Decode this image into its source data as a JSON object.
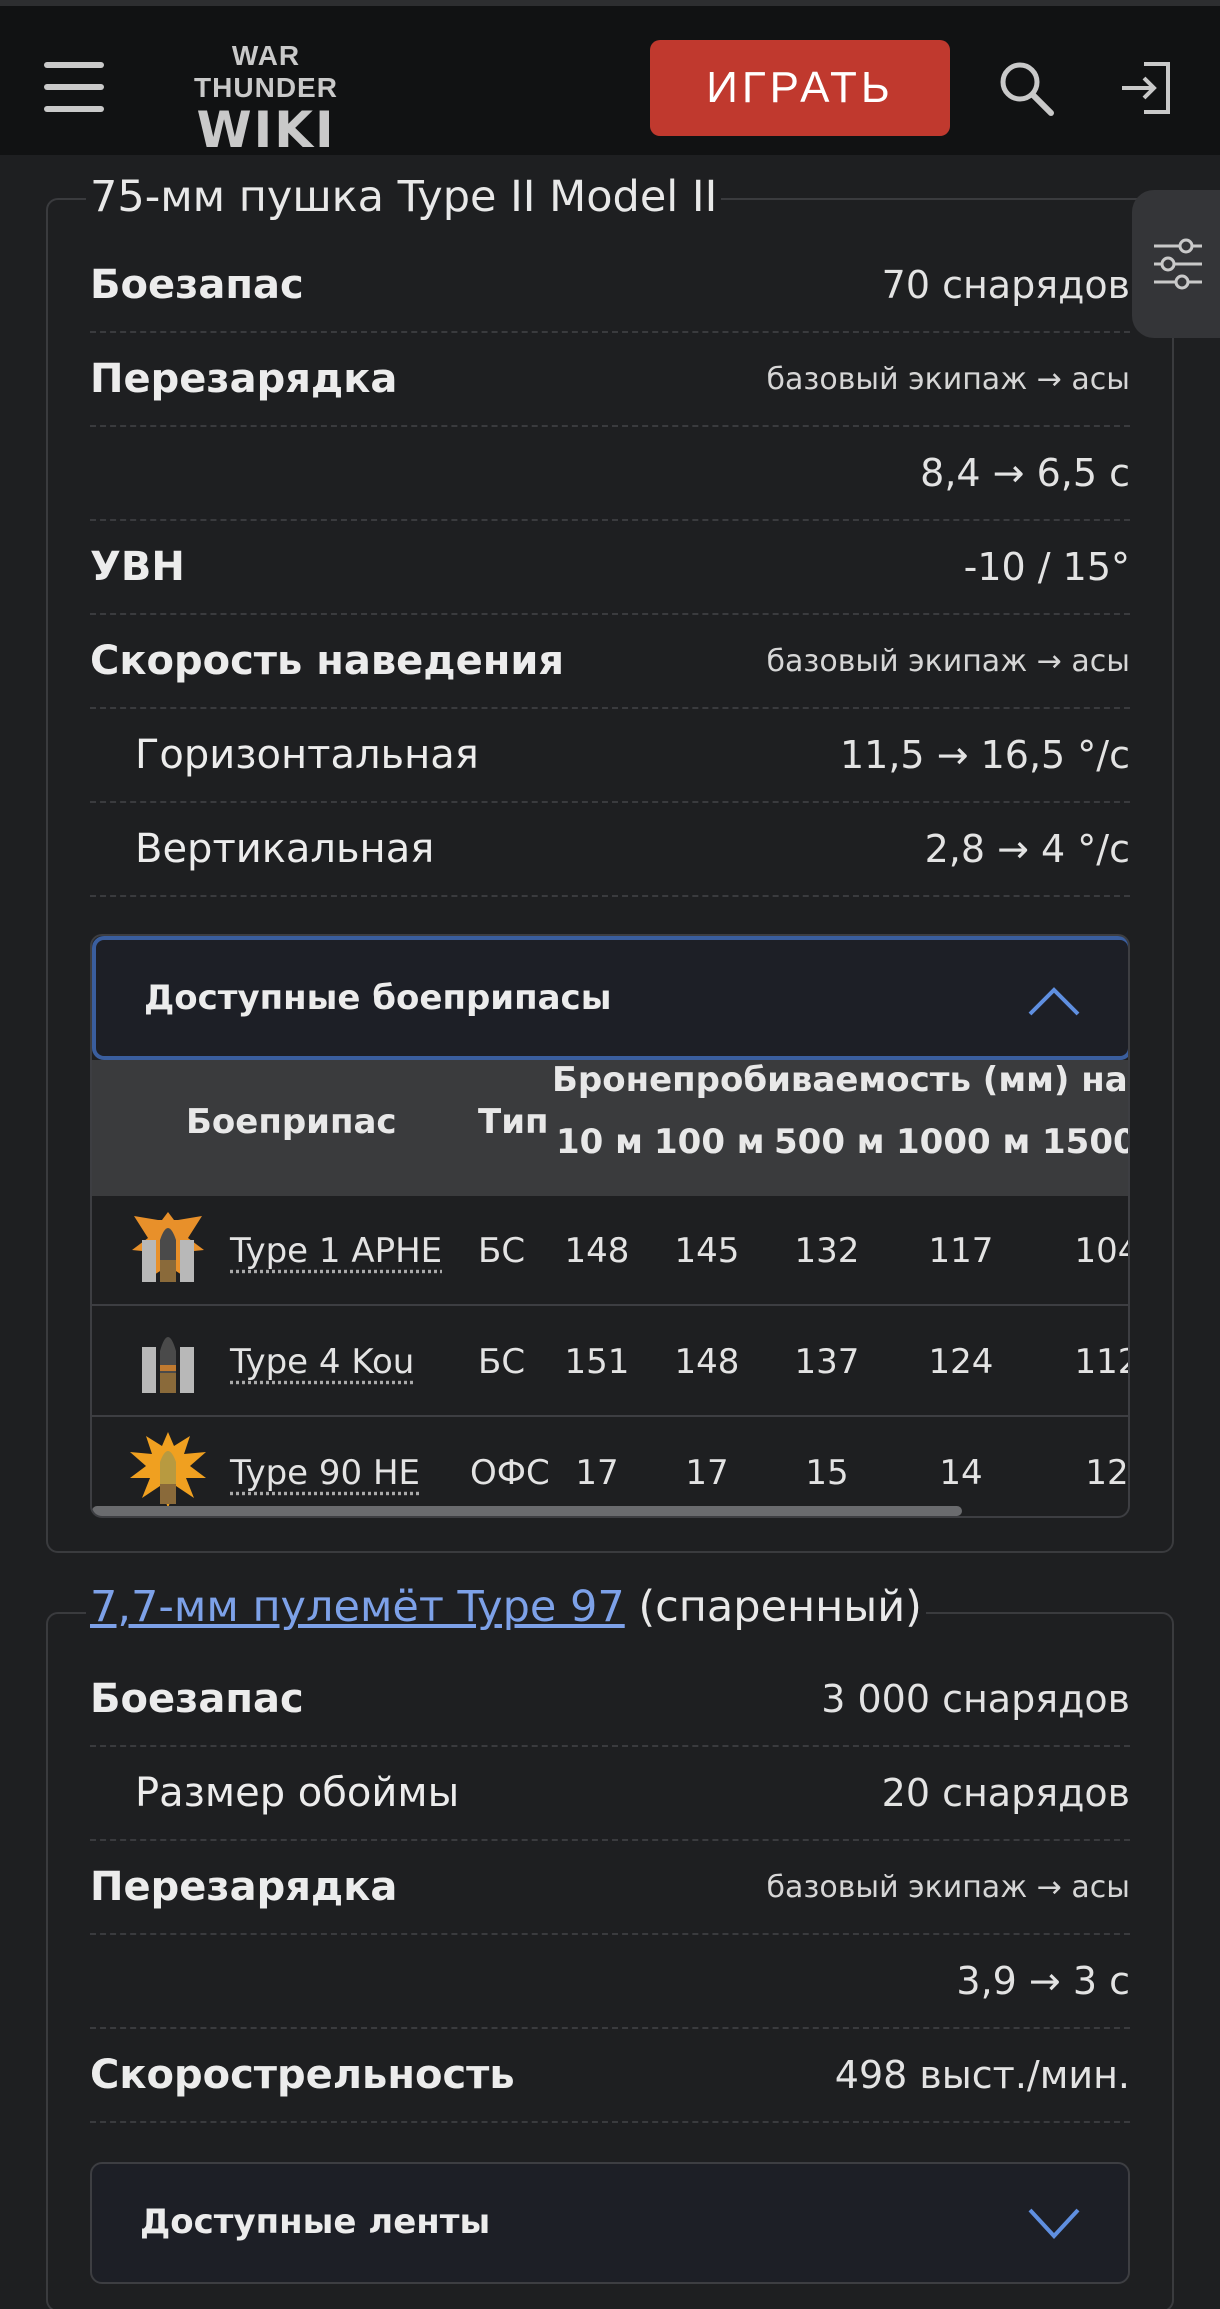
{
  "header": {
    "logo_line1": "WAR THUNDER",
    "logo_line2": "WIKI",
    "play_label": "ИГРАТЬ"
  },
  "gun": {
    "title": "75-мм пушка Type II Model II",
    "rows": [
      {
        "label": "Боезапас",
        "value": "70 снарядов"
      },
      {
        "label": "Перезарядка",
        "value": "базовый экипаж → асы"
      },
      {
        "label": "",
        "value": "8,4 → 6,5 с"
      },
      {
        "label": "УВН",
        "value": "-10 / 15°"
      },
      {
        "label": "Скорость наведения",
        "value": "базовый экипаж → асы"
      },
      {
        "label": "Горизонтальная",
        "value": "11,5 → 16,5 °/с"
      },
      {
        "label": "Вертикальная",
        "value": "2,8 → 4 °/с"
      }
    ],
    "ammo": {
      "title": "Доступные боеприпасы",
      "headers": {
        "shell": "Боеприпас",
        "type": "Тип",
        "pen": "Бронепробиваемость (мм) на ра",
        "d10": "10 м",
        "d100": "100 м",
        "d500": "500 м",
        "d1000": "1000 м",
        "d1500": "1500"
      },
      "rows": [
        {
          "name": "Type 1 APHE",
          "type": "БС",
          "v10": "148",
          "v100": "145",
          "v500": "132",
          "v1000": "117",
          "v1500": "104"
        },
        {
          "name": "Type 4 Kou",
          "type": "БС",
          "v10": "151",
          "v100": "148",
          "v500": "137",
          "v1000": "124",
          "v1500": "112"
        },
        {
          "name": "Type 90 HE",
          "type": "ОФС",
          "v10": "17",
          "v100": "17",
          "v500": "15",
          "v1000": "14",
          "v1500": "12"
        }
      ]
    }
  },
  "mg": {
    "title_link": "7,7-мм пулемёт Type 97",
    "title_suffix": " (спаренный)",
    "rows": [
      {
        "label": "Боезапас",
        "value": "3 000 снарядов"
      },
      {
        "label": "Размер обоймы",
        "value": "20 снарядов"
      },
      {
        "label": "Перезарядка",
        "value": "базовый экипаж → асы"
      },
      {
        "label": "",
        "value": "3,9 → 3 с"
      },
      {
        "label": "Скорострельность",
        "value": "498 выст./мин."
      }
    ],
    "belts_title": "Доступные ленты"
  }
}
